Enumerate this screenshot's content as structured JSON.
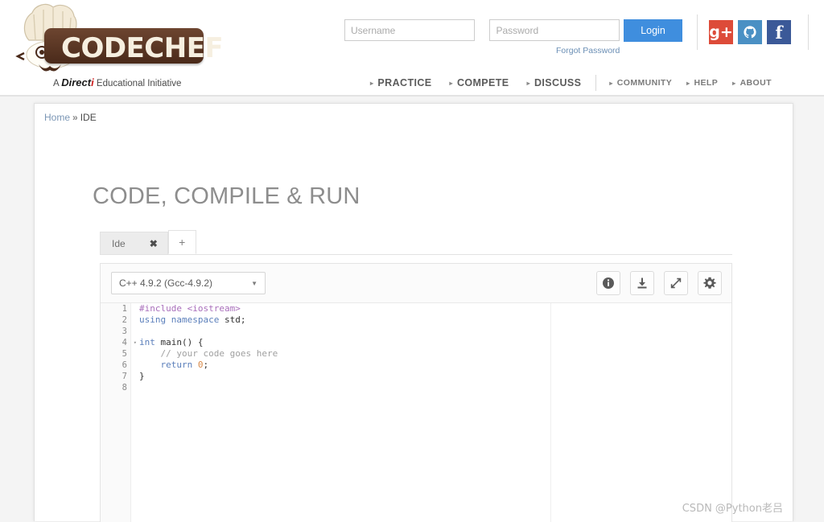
{
  "header": {
    "logo": {
      "wordmark": "CODECHEF",
      "tagline_prefix": "A ",
      "tagline_brand": "Direct",
      "tagline_brand_i": "i",
      "tagline_suffix": " Educational Initiative"
    },
    "login": {
      "username_placeholder": "Username",
      "username_value": "",
      "password_placeholder": "Password",
      "password_value": "",
      "login_label": "Login",
      "forgot_label": "Forgot Password",
      "login_button_color": "#3f8ede"
    },
    "social": [
      {
        "name": "google-plus-icon",
        "glyph": "g+",
        "color": "#dd4b39"
      },
      {
        "name": "github-icon",
        "glyph": "",
        "color": "#4a90c4"
      },
      {
        "name": "facebook-icon",
        "glyph": "f",
        "color": "#3b5998"
      }
    ],
    "nav": {
      "primary": [
        "PRACTICE",
        "COMPETE",
        "DISCUSS"
      ],
      "secondary": [
        "COMMUNITY",
        "HELP",
        "ABOUT"
      ],
      "caret": "▸"
    }
  },
  "breadcrumb": {
    "home": "Home",
    "separator": "»",
    "current": "IDE"
  },
  "page": {
    "title": "CODE, COMPILE & RUN"
  },
  "tabs": {
    "items": [
      {
        "label": "Ide",
        "close": "✖"
      }
    ],
    "add_label": "+"
  },
  "editor": {
    "language": "C++ 4.9.2 (Gcc-4.9.2)",
    "language_caret": "▼",
    "toolbar": [
      {
        "name": "info-button",
        "title": "Info"
      },
      {
        "name": "download-button",
        "title": "Download"
      },
      {
        "name": "fullscreen-button",
        "title": "Expand"
      },
      {
        "name": "settings-button",
        "title": "Settings"
      }
    ],
    "line_numbers": [
      "1",
      "2",
      "3",
      "4",
      "5",
      "6",
      "7",
      "8"
    ],
    "fold_line": 4,
    "fold_caret": "▾",
    "code": [
      [
        {
          "t": "#include ",
          "c": "tok-pre"
        },
        {
          "t": "<iostream>",
          "c": "tok-pre"
        }
      ],
      [
        {
          "t": "using ",
          "c": "tok-kw"
        },
        {
          "t": "namespace ",
          "c": "tok-kw"
        },
        {
          "t": "std;",
          "c": "tok-plain"
        }
      ],
      [],
      [
        {
          "t": "int ",
          "c": "tok-kw"
        },
        {
          "t": "main() {",
          "c": "tok-plain"
        }
      ],
      [
        {
          "t": "    // your code goes here",
          "c": "tok-comment"
        }
      ],
      [
        {
          "t": "    return ",
          "c": "tok-kw"
        },
        {
          "t": "0",
          "c": "tok-num"
        },
        {
          "t": ";",
          "c": "tok-plain"
        }
      ],
      [
        {
          "t": "}",
          "c": "tok-plain"
        }
      ],
      []
    ]
  },
  "watermark": "CSDN @Python老吕"
}
